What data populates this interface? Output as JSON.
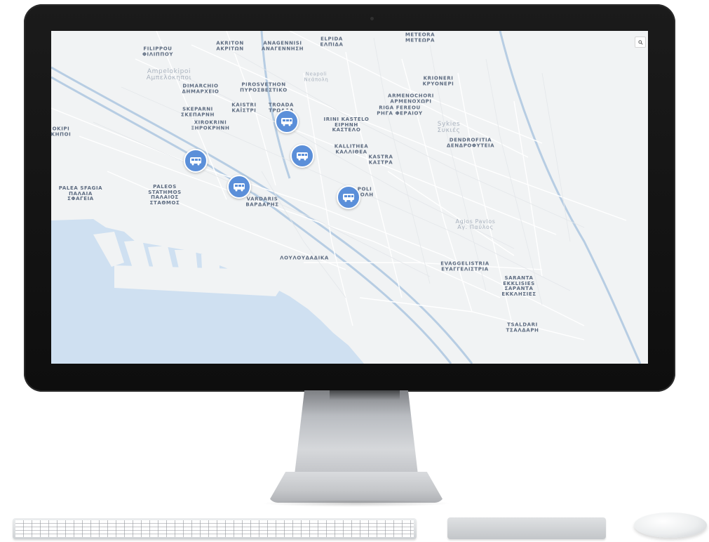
{
  "map": {
    "search_icon": "search-icon",
    "water_color": "#cfe0f1",
    "land_color": "#f1f3f4",
    "road_color": "#ffffff",
    "highway_color": "#9fbbd8",
    "marker_color": "#5b8fd9",
    "labels": {
      "filippou": "FILIPPOU\nΦΙΛΙΠΠΟΥ",
      "akriton": "AKRITON\nΑΚΡΙΤΩΝ",
      "anagennisi": "ANAGENNISI\nΑΝΑΓΕΝΝΗΣΗ",
      "elpida": "ELPIDA\nΕΛΠΙΔΑ",
      "meteora": "METEORA\nΜΕΤΕΩΡΑ",
      "ampelokipoi": "Ampelokipoi\nΑμπελόκηποι",
      "neapoli": "Neapoli\nΝεάπολη",
      "kriokeri": "KRIONERI\nΚΡΥΟΝΕΡΙ",
      "dimarchio": "DIMARCHIO\nΔΗΜΑΡΧΕΙΟ",
      "pirosvestiko": "PIROSVETHON\nΠΥΡΟΣΒΕΣΤΙΚΟ",
      "armenochori": "ARMENOCHORI\nΑΡΜΕΝΟΧΩΡΙ",
      "skepasti": "SKEPARNI\nΣΚΕΠΑΡΝΗ",
      "kaistri": "KAISTRI\nΚΑΪΣΤΡΙ",
      "troada": "TROADA\nΤΡΩΑΔΑ",
      "riga_fereou": "RIGA FEREOU\nΡΗΓΑ ΦΕΡΑΙΟΥ",
      "irini_kastelo": "IRINI KASTELO\nΕΙΡΗΝΗ\nΚΑΣΤΕΛΟ",
      "sykies": "Sykies\nΣυκιές",
      "xirokrini": "XIROKRINI\nΞΗΡΟΚΡΗΝΗ",
      "dendrofytia": "DENDROFITIA\nΔΕΝΔΡΟΦΥΤΕΙΑ",
      "kallithea": "KALLITHEA\nΚΑΛΛΙΘΕΑ",
      "kastra": "KASTRA\nΚΑΣΤΡΑ",
      "palea_sfageia": "PALEA SFAGIA\nΠΑΛΑΙΑ\nΣΦΑΓΕΙΑ",
      "paleos_stathmos": "PALEOS\nSTATHMOS\nΠΑΛΑΙΟΣ\nΣΤΑΘΜΟΣ",
      "vardaris": "VARDARIS\nΒΑΡΔΑΡΗΣ",
      "ano_poli": "ANO POLI\nΑΝΩ ΠΟΛΗ",
      "agios_pavlos": "Agios Pavlos\nΑγ. Παύλος",
      "ladadika": "ΛΟΥΛΟΥΔΑΔΙΚΑ",
      "evaggelistria": "EVAGGELISTRIA\nΕΥΑΓΓΕΛΙΣΤΡΙΑ",
      "saranta_ekklisies": "SARANTA\nEKKLISIES\nΣΑΡΑΝΤΑ\nΕΚΚΛΗΣΙΕΣ",
      "tsaldari": "TSALDARI\nΤΣΑΛΔΑΡΗ",
      "okipi": "OKIPI\nΚΗΠΟΙ"
    },
    "bus_markers": [
      {
        "name": "bus-stop-1",
        "icon": "bus-icon"
      },
      {
        "name": "bus-stop-2",
        "icon": "bus-icon"
      },
      {
        "name": "bus-stop-3",
        "icon": "bus-icon"
      },
      {
        "name": "bus-stop-4",
        "icon": "bus-icon"
      },
      {
        "name": "bus-stop-5",
        "icon": "bus-icon"
      }
    ]
  },
  "device": {
    "monitor_color": "#111111",
    "stand_color": "#c5c7ca",
    "accessories": [
      "keyboard",
      "trackpad",
      "mouse"
    ]
  }
}
